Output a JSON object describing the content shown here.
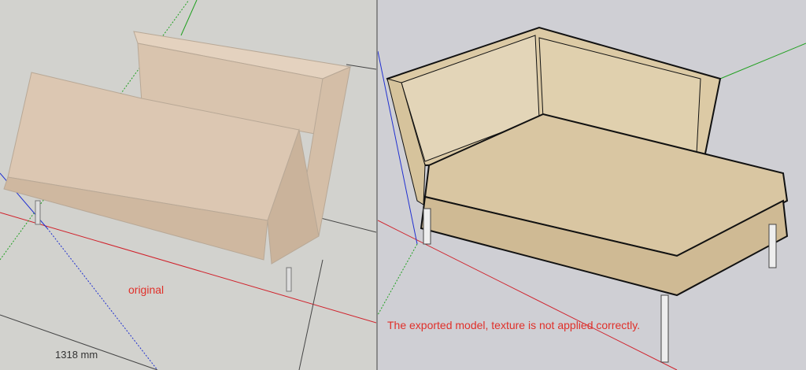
{
  "left_panel": {
    "caption": "original",
    "dimension": "1318 mm",
    "fabric_color": "#dcc7b2"
  },
  "right_panel": {
    "caption": "The exported model, texture is not applied correctly.",
    "fabric_color": "#d9c9a6"
  },
  "axis_colors": {
    "red": "#d0202a",
    "green": "#20a020",
    "blue": "#2030d0"
  }
}
